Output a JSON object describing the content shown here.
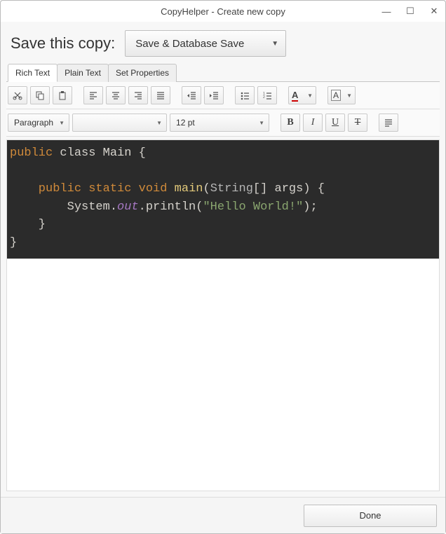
{
  "window": {
    "title": "CopyHelper - Create new copy"
  },
  "save": {
    "label": "Save this copy:",
    "combo": "Save & Database Save"
  },
  "tabs": {
    "rich": "Rich Text",
    "plain": "Plain Text",
    "props": "Set Properties"
  },
  "block_format": "Paragraph",
  "font_name": "",
  "font_size": "12 pt",
  "code": {
    "t1a": "public",
    "t1b": " class ",
    "t1c": "Main",
    "t1d": " {",
    "blank": "",
    "t2a": "    public",
    "t2b": " static",
    "t2c": " void ",
    "t2d": "main",
    "t2e": "(",
    "t2f": "String",
    "t2g": "[] args) {",
    "t3a": "        System.",
    "t3b": "out",
    "t3c": ".println(",
    "t3d": "\"Hello World!\"",
    "t3e": ");",
    "t4": "    }",
    "t5": "}"
  },
  "footer": {
    "done": "Done"
  }
}
